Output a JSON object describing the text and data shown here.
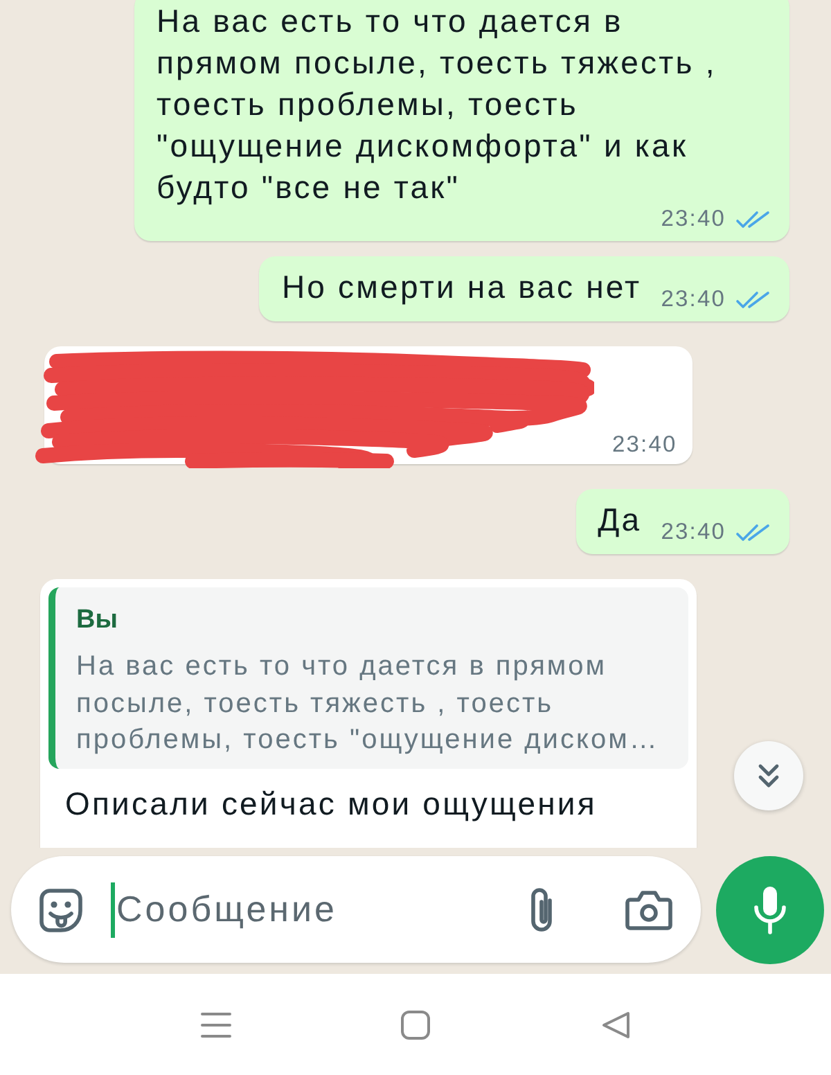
{
  "messages": [
    {
      "kind": "outgoing",
      "text": "На вас есть то что дается в прямом посыле, тоесть тяжесть , тоесть проблемы, тоесть \"ощущение дискомфорта\" и как будто \"все не так\"",
      "time": "23:40",
      "read": true
    },
    {
      "kind": "outgoing",
      "text": "Но смерти на вас нет",
      "time": "23:40",
      "read": true
    },
    {
      "kind": "redacted",
      "time": "23:40"
    },
    {
      "kind": "outgoing",
      "text": "Да",
      "time": "23:40",
      "read": true
    },
    {
      "kind": "reply",
      "quote": {
        "author": "Вы",
        "text": "На вас есть то что дается в прямом посыле, тоесть тяжесть , тоесть проблемы, тоесть \"ощущение диском…"
      },
      "text": "Описали сейчас мои ощущения"
    }
  ],
  "composer": {
    "placeholder": "Сообщение",
    "focused": true
  }
}
